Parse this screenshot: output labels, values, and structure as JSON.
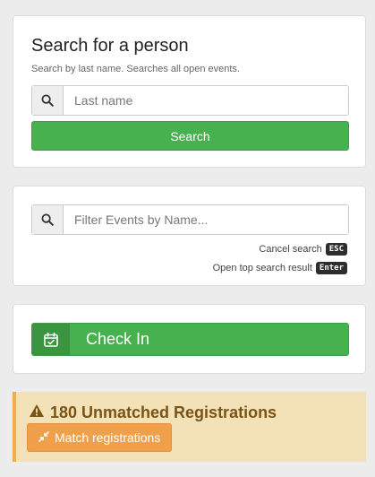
{
  "search_panel": {
    "title": "Search for a person",
    "subtitle": "Search by last name. Searches all open events.",
    "input_placeholder": "Last name",
    "input_value": "",
    "search_button": "Search"
  },
  "filter_panel": {
    "input_placeholder": "Filter Events by Name...",
    "input_value": "",
    "cancel_hint": "Cancel search",
    "cancel_key": "ESC",
    "open_hint": "Open top search result",
    "open_key": "Enter"
  },
  "checkin_panel": {
    "button_label": "Check In"
  },
  "alert": {
    "title": "180 Unmatched Registrations",
    "match_button": "Match registrations"
  },
  "icons": {
    "search": "search-icon",
    "calendar_check": "calendar-check-icon",
    "warning": "warning-icon",
    "compress": "compress-icon"
  },
  "colors": {
    "success": "#47b04f",
    "warning_bg": "#f3e2b8",
    "warning_text": "#7a5416",
    "warning_button": "#f0a04a"
  }
}
